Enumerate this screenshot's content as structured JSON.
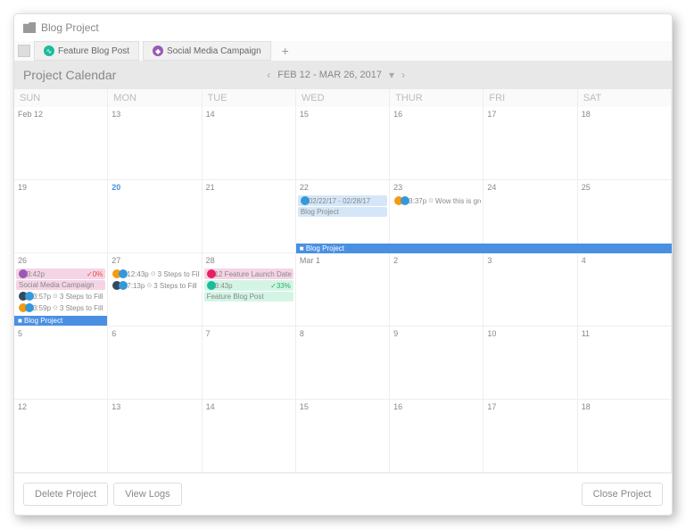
{
  "header": {
    "title": "Blog Project"
  },
  "tabs": [
    {
      "label": "Feature Blog Post",
      "color": "#1abc9c"
    },
    {
      "label": "Social Media Campaign",
      "color": "#9b59b6"
    }
  ],
  "toolbar": {
    "title": "Project Calendar",
    "range": "FEB 12 - MAR 26, 2017"
  },
  "days": [
    "SUN",
    "MON",
    "TUE",
    "WED",
    "THUR",
    "FRI",
    "SAT"
  ],
  "weeks": [
    [
      {
        "n": "Feb 12"
      },
      {
        "n": "13"
      },
      {
        "n": "14"
      },
      {
        "n": "15"
      },
      {
        "n": "16"
      },
      {
        "n": "17"
      },
      {
        "n": "18"
      }
    ],
    [
      {
        "n": "19"
      },
      {
        "n": "20",
        "today": true
      },
      {
        "n": "21"
      },
      {
        "n": "22",
        "events": [
          {
            "cls": "ev-blue",
            "t": "02/22/17 - 02/28/17",
            "ic": [
              "ic-blue"
            ]
          },
          {
            "cls": "ev-blue",
            "t": "Blog Project"
          }
        ]
      },
      {
        "n": "23",
        "events": [
          {
            "cls": "ev-white",
            "t": "3:37p",
            "txt": "Wow this is great!",
            "ic": [
              "ic-orange",
              "ic-blue"
            ],
            "clock": true
          }
        ]
      },
      {
        "n": "24"
      },
      {
        "n": "25"
      }
    ],
    [
      {
        "n": "26",
        "events": [
          {
            "cls": "ev-pink",
            "t": "3:42p",
            "ic": [
              "ic-purple"
            ],
            "pct": "✓0%"
          },
          {
            "cls": "ev-pink",
            "t": "Social Media Campaign"
          },
          {
            "cls": "ev-white",
            "t": "3:57p",
            "txt": "3 Steps to Fill",
            "ic": [
              "ic-dark",
              "ic-blue"
            ],
            "clock": true
          },
          {
            "cls": "ev-white",
            "t": "3:59p",
            "txt": "3 Steps to Fill",
            "ic": [
              "ic-orange",
              "ic-blue"
            ],
            "clock": true
          }
        ],
        "bar": "■ Blog Project"
      },
      {
        "n": "27",
        "events": [
          {
            "cls": "ev-white",
            "t": "12:43p",
            "txt": "3 Steps to Fill",
            "ic": [
              "ic-orange",
              "ic-blue"
            ],
            "clock": true
          },
          {
            "cls": "ev-white",
            "t": "7:13p",
            "txt": "3 Steps to Fill",
            "ic": [
              "ic-dark",
              "ic-blue"
            ],
            "clock": true
          }
        ]
      },
      {
        "n": "28",
        "events": [
          {
            "cls": "ev-pink",
            "t": "12 Feature Launch Date",
            "ic": [
              "ic-pink"
            ]
          },
          {
            "cls": "ev-teal",
            "t": "3:43p",
            "ic": [
              "ic-teal"
            ],
            "pct": "✓33%"
          },
          {
            "cls": "ev-teal",
            "t": "Feature Blog Post"
          }
        ]
      },
      {
        "n": "Mar 1"
      },
      {
        "n": "2"
      },
      {
        "n": "3"
      },
      {
        "n": "4"
      }
    ],
    [
      {
        "n": "5"
      },
      {
        "n": "6"
      },
      {
        "n": "7"
      },
      {
        "n": "8"
      },
      {
        "n": "9"
      },
      {
        "n": "10"
      },
      {
        "n": "11"
      }
    ],
    [
      {
        "n": "12"
      },
      {
        "n": "13"
      },
      {
        "n": "14"
      },
      {
        "n": "15"
      },
      {
        "n": "16"
      },
      {
        "n": "17"
      },
      {
        "n": "18"
      }
    ]
  ],
  "bars": {
    "row2": "■ Blog Project"
  },
  "footer": {
    "delete": "Delete Project",
    "logs": "View Logs",
    "close": "Close Project"
  }
}
